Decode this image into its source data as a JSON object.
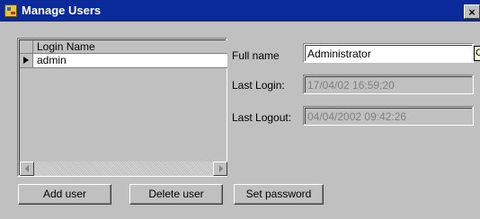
{
  "window": {
    "title": "Manage Users",
    "close_glyph": "×"
  },
  "grid": {
    "column_header": "Login Name",
    "rows": [
      {
        "login": "admin",
        "selected": true
      }
    ]
  },
  "details": {
    "full_name_label": "Full name",
    "full_name_value": "Administrator",
    "last_login_label": "Last Login:",
    "last_login_value": "17/04/02 16:59:20",
    "last_logout_label": "Last Logout:",
    "last_logout_value": "04/04/2002 09:42:26"
  },
  "hint": {
    "text": "C"
  },
  "buttons": {
    "add_user": "Add user",
    "delete_user": "Delete user",
    "set_password": "Set password"
  },
  "icons": {
    "app": "users-app-icon",
    "close": "close-icon",
    "row_indicator": "row-pointer-icon",
    "scroll_left": "scroll-left-arrow-icon",
    "scroll_right": "scroll-right-arrow-icon"
  }
}
